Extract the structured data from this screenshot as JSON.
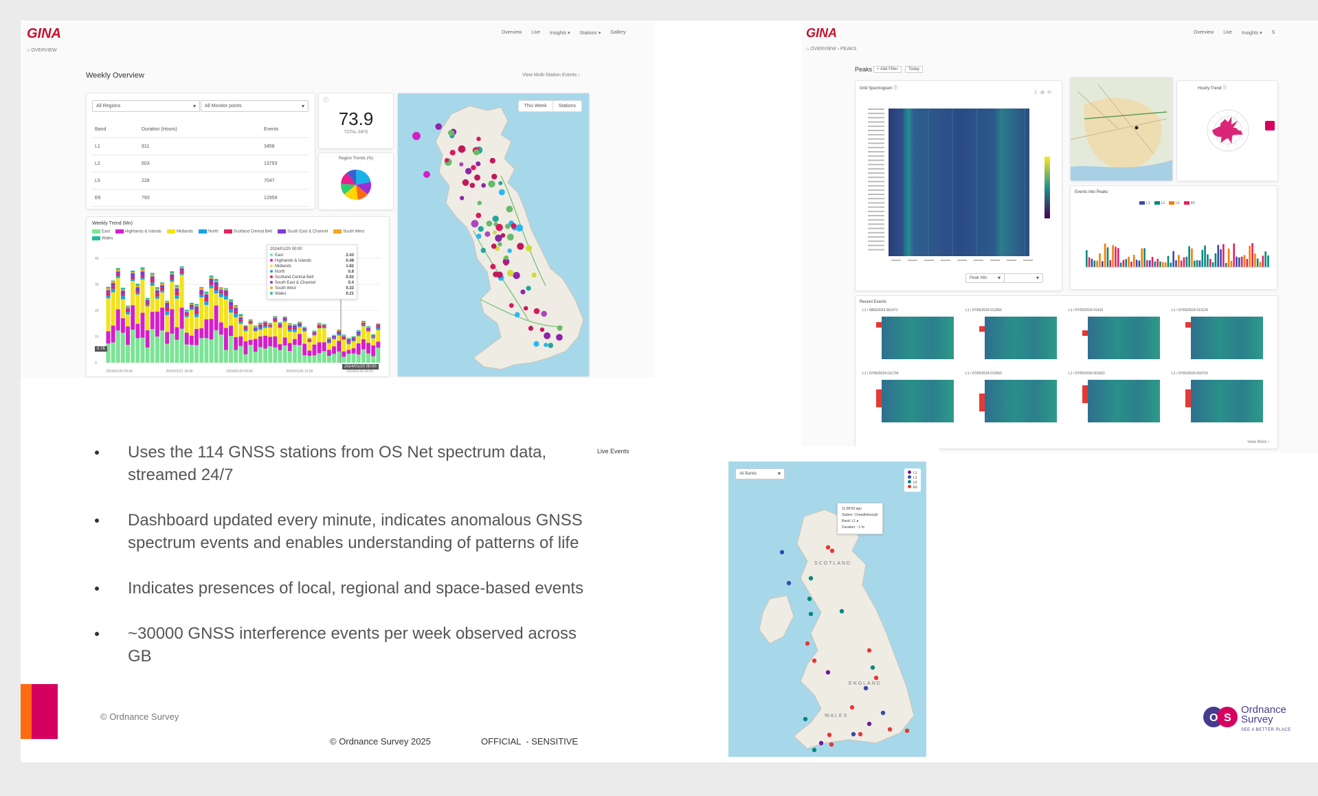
{
  "slide": {
    "bullets": [
      "Uses the 114 GNSS stations from OS Net spectrum data, streamed 24/7",
      "Dashboard updated every minute, indicates anomalous GNSS spectrum events and enables understanding of patterns of life",
      "Indicates presences of local, regional and space-based events",
      "~30000 GNSS interference events per week observed across GB"
    ],
    "copyright_small": "© Ordnance Survey",
    "copyright_footer": "© Ordnance Survey 2025",
    "classification": "OFFICIAL  - SENSITIVE",
    "os_logo": {
      "line1": "Ordnance",
      "line2": "Survey",
      "tagline": "SEE A BETTER PLACE"
    },
    "accent_colors": {
      "orange": "#ff6a13",
      "magenta": "#d6005f",
      "red": "#c8102e"
    }
  },
  "weekly": {
    "brand": "GINA",
    "nav": [
      "Overview",
      "Live",
      "Insights ▾",
      "Stations ▾",
      "Gallery"
    ],
    "breadcrumb": "OVERVIEW",
    "title": "Weekly Overview",
    "view_link": "View Multi-Station Events ›",
    "filters": {
      "region": "All Regions",
      "stations": "All Monitor points"
    },
    "table": {
      "headers": [
        "Band",
        "Duration (Hours)",
        "Events"
      ],
      "rows": [
        [
          "L1",
          "911",
          "3458"
        ],
        [
          "L2",
          "603",
          "13793"
        ],
        [
          "L5",
          "228",
          "7047"
        ],
        [
          "E6",
          "793",
          "12959"
        ]
      ]
    },
    "total": {
      "value": "73.9",
      "label": "TOTAL INFO"
    },
    "region_pie": {
      "title": "Region Trends (%)",
      "slice_colors": [
        "#1cb0e8",
        "#9b30d9",
        "#ff6a13",
        "#ffd600",
        "#2ecc71",
        "#e91e8c",
        "#3a5fcd"
      ],
      "slice_values": [
        22,
        14,
        12,
        16,
        12,
        14,
        10
      ]
    },
    "map_toggle": {
      "this_week": "This Week",
      "stations": "Stations"
    },
    "trend": {
      "title": "Weekly Trend (Mn)",
      "legend": [
        {
          "name": "East",
          "color": "#7be495"
        },
        {
          "name": "Highlands & Islands",
          "color": "#d41fc9"
        },
        {
          "name": "Midlands",
          "color": "#f3e21a"
        },
        {
          "name": "North",
          "color": "#1aa1e3"
        },
        {
          "name": "Scotland Central Belt",
          "color": "#e0245e"
        },
        {
          "name": "South East & Channel",
          "color": "#7a3fd1"
        },
        {
          "name": "South West",
          "color": "#f5a623"
        },
        {
          "name": "Wales",
          "color": "#1fbf9a"
        }
      ],
      "tooltip": {
        "date": "2024/01/20 00:00",
        "rows": [
          {
            "name": "East",
            "value": "2.43"
          },
          {
            "name": "Highlands & Islands",
            "value": "0.48"
          },
          {
            "name": "Midlands",
            "value": "1.82"
          },
          {
            "name": "North",
            "value": "0.8"
          },
          {
            "name": "Scotland Central Belt",
            "value": "0.02"
          },
          {
            "name": "South East & Channel",
            "value": "0.4"
          },
          {
            "name": "South West",
            "value": "0.33"
          },
          {
            "name": "Wales",
            "value": "0.21"
          }
        ]
      },
      "y_ticks": [
        "40",
        "30",
        "20",
        "10",
        "0"
      ],
      "x_ticks": [
        "2024/01/20 00:00",
        "2024/01/21 18:00",
        "2024/01/23 06:00",
        "2024/01/25 12:00",
        "2024/01/26 06:00"
      ],
      "highlight_left": "0.76",
      "highlight_right": "2024/01/20 00:00"
    }
  },
  "peaks": {
    "brand": "GINA",
    "nav": [
      "Overview",
      "Live",
      "Insights ▾",
      "S"
    ],
    "breadcrumb": "OVERVIEW  ›  PEAKS",
    "title": "Peaks",
    "chips": [
      "+ Add Filter",
      "Today"
    ],
    "spectrogram_title": "Grid Spectrogram ⓘ",
    "spectrogram_select": "Peak Hits",
    "hourly_title": "Hourly Trend ⓘ",
    "peaks_title": "Events Into Peaks",
    "peaks_legend": [
      "L1",
      "L2",
      "L5",
      "E6"
    ],
    "recent_title": "Recent Events",
    "recent_labels": [
      "L1 / 0805/2024 001471",
      "L1 / 07/05/2024 012956",
      "L1 / 07/05/2024 01418",
      "L1 / 07/05/2024 013124",
      "L1 / 07/05/2024 011734",
      "L1 / 07/05/2024 012550",
      "L1 / 07/05/2024 001622",
      "L1 / 07/05/2024 003710"
    ],
    "view_more": "View More ›"
  },
  "live": {
    "title": "Live Events",
    "filter": "All Bands",
    "legend": [
      {
        "name": "L1",
        "color": "#6a1b9a"
      },
      {
        "name": "L2",
        "color": "#3949ab"
      },
      {
        "name": "L5",
        "color": "#00897b"
      },
      {
        "name": "E6",
        "color": "#e53935"
      }
    ],
    "popup": [
      "11:08:59 ago",
      "Station: Cheadlebourgh",
      "Band: L1 ●",
      "Duration: ~1 hr"
    ],
    "labels": {
      "scotland": "SCOTLAND",
      "england": "ENGLAND",
      "wales": "WALES"
    }
  }
}
